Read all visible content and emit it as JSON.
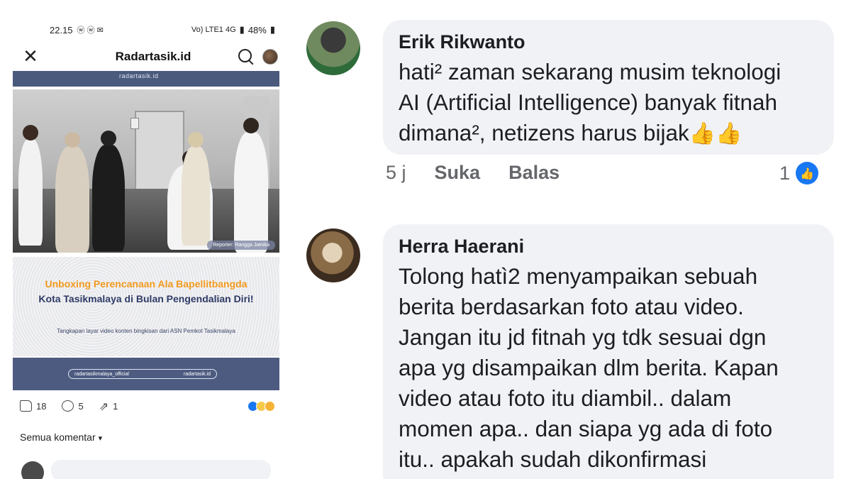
{
  "phone": {
    "status": {
      "time": "22.15",
      "left_icons": "ⓦ ⓦ ✉",
      "net": "Vo) LTE1 4G",
      "battery": "48%"
    },
    "appbar": {
      "title": "Radartasik.id"
    },
    "media": {
      "top_label": "radartasik.id",
      "reporter": "Reporter: Rangga Jatnika",
      "caption_highlight": "Unboxing Perencanaan Ala Bapellitbangda",
      "caption_rest": "Kota Tasikmalaya di Bulan Pengendalian Diri!",
      "caption_sub": "Tangkapan layar video konten bingkisan dari ASN Pemkot Tasikmalaya",
      "handle_ig": "radartasikmalaya_official",
      "handle_site": "radartasik.id"
    },
    "actions": {
      "likes": "18",
      "comments": "5",
      "shares": "1"
    },
    "sort_label": "Semua komentar"
  },
  "comments": [
    {
      "name": "Erik Rikwanto",
      "text": "hati² zaman sekarang musim teknologi\nAI  (Artificial Intelligence) banyak fitnah\ndimana², netizens harus bijak",
      "time": "5 j",
      "like_label": "Suka",
      "reply_label": "Balas",
      "like_count": "1"
    },
    {
      "name": "Herra Haerani",
      "text": "Tolong hatì2 menyampaikan sebuah\nberita berdasarkan foto atau video.\nJangan itu jd fitnah yg tdk sesuai dgn\napa yg disampaikan dlm berita. Kapan\nvideo atau foto itu diambil.. dalam\nmomen apa.. dan siapa yg ada di foto\nitu.. apakah sudah dikonfirmasi"
    }
  ],
  "colors": {
    "bubble": "#f0f2f5",
    "like_blue": "#1877f2",
    "caption_navy": "#2f3b66",
    "caption_orange": "#f29a1f",
    "footer_navy": "#4d5b80"
  }
}
